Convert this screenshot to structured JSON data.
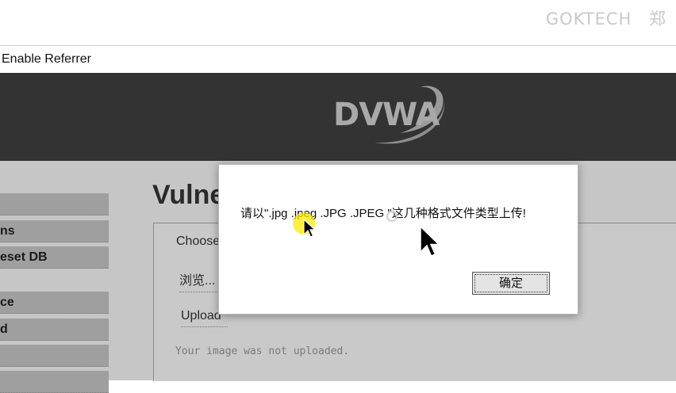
{
  "watermark": {
    "text": "GOKTECH",
    "suffix": "郑"
  },
  "toolbar": {
    "enable_referrer": "Enable Referrer"
  },
  "header": {
    "logo_text": "DVWA",
    "logo_color": "#a9a9a9",
    "background": "#333333"
  },
  "sidebar": {
    "items": [
      {
        "label": ""
      },
      {
        "label": "ns"
      },
      {
        "label": "eset DB"
      },
      {
        "label": "ce"
      },
      {
        "label": "d"
      },
      {
        "label": ""
      },
      {
        "label": ""
      }
    ]
  },
  "main": {
    "title": "Vulne",
    "choose_label": "Choose",
    "browse_button": "浏览...",
    "upload_button": "Upload",
    "status": "Your image was not uploaded."
  },
  "dialog": {
    "message": "请以\".jpg .jpeg .JPG .JPEG \"这几种格式文件类型上传!",
    "ok_button": "确定"
  },
  "colors": {
    "highlight": "#ffeb00",
    "dim_page": "#c6c6c6"
  }
}
